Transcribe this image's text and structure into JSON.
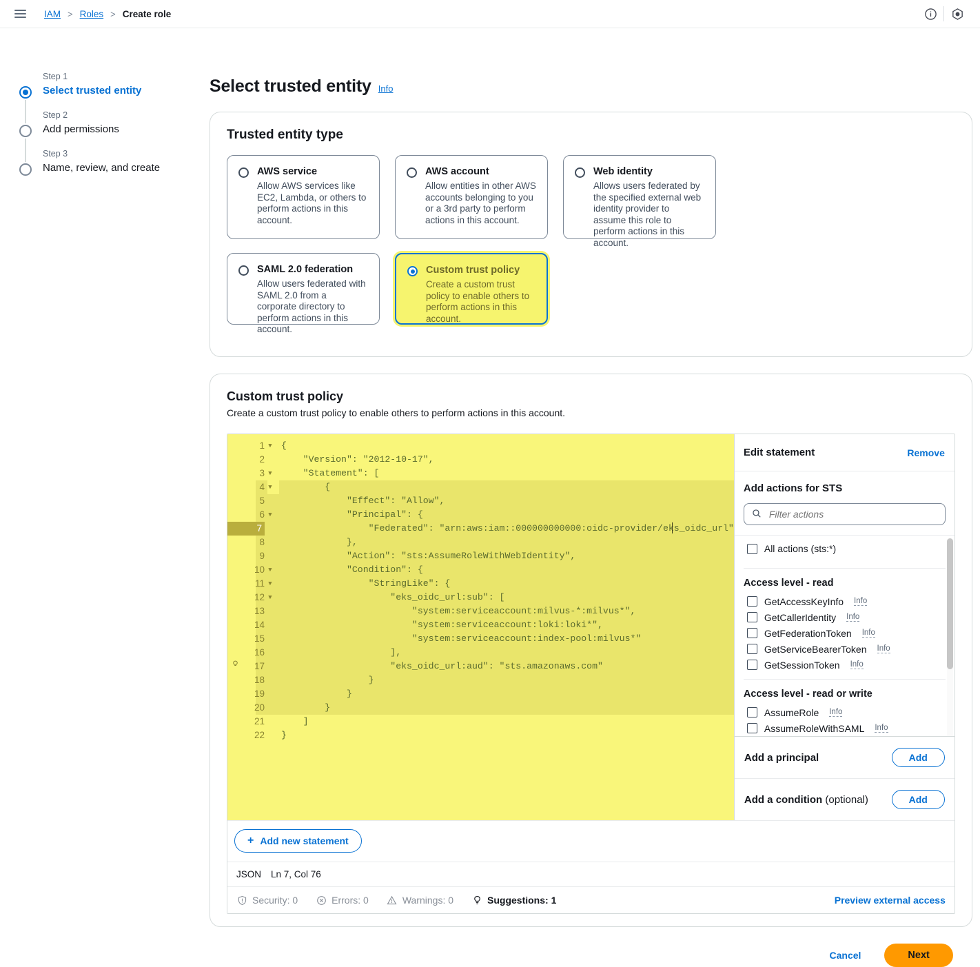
{
  "topbar": {
    "menu_icon": "hamburger-icon",
    "breadcrumbs": [
      {
        "label": "IAM",
        "link": true
      },
      {
        "label": "Roles",
        "link": true
      },
      {
        "label": "Create role",
        "link": false
      }
    ],
    "separator": ">",
    "icons": [
      {
        "name": "info-circle-icon",
        "glyph": "ⓘ"
      },
      {
        "name": "settings-hex-icon",
        "glyph": "⬡"
      }
    ]
  },
  "steps": [
    {
      "num": "Step 1",
      "label": "Select trusted entity",
      "active": true
    },
    {
      "num": "Step 2",
      "label": "Add permissions",
      "active": false
    },
    {
      "num": "Step 3",
      "label": "Name, review, and create",
      "active": false
    }
  ],
  "page": {
    "title": "Select trusted entity",
    "info_label": "Info"
  },
  "trusted_entity": {
    "section_title": "Trusted entity type",
    "cards": [
      {
        "label": "AWS service",
        "desc": "Allow AWS services like EC2, Lambda, or others to perform actions in this account.",
        "selected": false,
        "highlighted": false
      },
      {
        "label": "AWS account",
        "desc": "Allow entities in other AWS accounts belonging to you or a 3rd party to perform actions in this account.",
        "selected": false,
        "highlighted": false
      },
      {
        "label": "Web identity",
        "desc": "Allows users federated by the specified external web identity provider to assume this role to perform actions in this account.",
        "selected": false,
        "highlighted": false
      },
      {
        "label": "SAML 2.0 federation",
        "desc": "Allow users federated with SAML 2.0 from a corporate directory to perform actions in this account.",
        "selected": false,
        "highlighted": false
      },
      {
        "label": "Custom trust policy",
        "desc": "Create a custom trust policy to enable others to perform actions in this account.",
        "selected": true,
        "highlighted": true
      }
    ]
  },
  "custom_policy": {
    "section_title": "Custom trust policy",
    "section_desc": "Create a custom trust policy to enable others to perform actions in this account.",
    "code_lines": [
      {
        "n": "1",
        "fold": true,
        "bulb": false,
        "text": "{"
      },
      {
        "n": "2",
        "fold": false,
        "bulb": false,
        "text": "    \"Version\": \"2012-10-17\","
      },
      {
        "n": "3",
        "fold": true,
        "bulb": false,
        "text": "    \"Statement\": ["
      },
      {
        "n": "4",
        "fold": true,
        "bulb": false,
        "text": "        {"
      },
      {
        "n": "5",
        "fold": false,
        "bulb": false,
        "text": "            \"Effect\": \"Allow\","
      },
      {
        "n": "6",
        "fold": true,
        "bulb": false,
        "text": "            \"Principal\": {"
      },
      {
        "n": "7",
        "fold": false,
        "bulb": false,
        "text": "                \"Federated\": \"arn:aws:iam::000000000000:oidc-provider/eks_oidc_url\"",
        "current": true
      },
      {
        "n": "8",
        "fold": false,
        "bulb": false,
        "text": "            },"
      },
      {
        "n": "9",
        "fold": false,
        "bulb": false,
        "text": "            \"Action\": \"sts:AssumeRoleWithWebIdentity\","
      },
      {
        "n": "10",
        "fold": true,
        "bulb": false,
        "text": "            \"Condition\": {"
      },
      {
        "n": "11",
        "fold": true,
        "bulb": false,
        "text": "                \"StringLike\": {"
      },
      {
        "n": "12",
        "fold": true,
        "bulb": false,
        "text": "                    \"eks_oidc_url:sub\": ["
      },
      {
        "n": "13",
        "fold": false,
        "bulb": false,
        "text": "                        \"system:serviceaccount:milvus-*:milvus*\","
      },
      {
        "n": "14",
        "fold": false,
        "bulb": false,
        "text": "                        \"system:serviceaccount:loki:loki*\","
      },
      {
        "n": "15",
        "fold": false,
        "bulb": false,
        "text": "                        \"system:serviceaccount:index-pool:milvus*\""
      },
      {
        "n": "16",
        "fold": false,
        "bulb": false,
        "text": "                    ],"
      },
      {
        "n": "17",
        "fold": false,
        "bulb": true,
        "text": "                    \"eks_oidc_url:aud\": \"sts.amazonaws.com\""
      },
      {
        "n": "18",
        "fold": false,
        "bulb": false,
        "text": "                }"
      },
      {
        "n": "19",
        "fold": false,
        "bulb": false,
        "text": "            }"
      },
      {
        "n": "20",
        "fold": false,
        "bulb": false,
        "text": "        }"
      },
      {
        "n": "21",
        "fold": false,
        "bulb": false,
        "text": "    ]"
      },
      {
        "n": "22",
        "fold": false,
        "bulb": false,
        "text": "}"
      }
    ],
    "add_statement_label": "Add new statement",
    "add_statement_plus": "+",
    "status": {
      "language": "JSON",
      "cursor": "Ln 7, Col 76",
      "security": "Security: 0",
      "errors": "Errors: 0",
      "warnings": "Warnings: 0",
      "suggestions": "Suggestions: 1",
      "preview_link": "Preview external access"
    }
  },
  "side_panel": {
    "head_title": "Edit statement",
    "remove_label": "Remove",
    "actions_title": "Add actions for STS",
    "filter_placeholder": "Filter actions",
    "all_actions_label": "All actions (sts:*)",
    "groups": [
      {
        "title": "Access level - read",
        "actions": [
          {
            "label": "GetAccessKeyInfo",
            "info": "Info"
          },
          {
            "label": "GetCallerIdentity",
            "info": "Info"
          },
          {
            "label": "GetFederationToken",
            "info": "Info"
          },
          {
            "label": "GetServiceBearerToken",
            "info": "Info"
          },
          {
            "label": "GetSessionToken",
            "info": "Info"
          }
        ]
      },
      {
        "title": "Access level - read or write",
        "actions": [
          {
            "label": "AssumeRole",
            "info": "Info"
          },
          {
            "label": "AssumeRoleWithSAML",
            "info": "Info"
          }
        ]
      }
    ],
    "principal": {
      "title": "Add a principal",
      "button": "Add"
    },
    "condition": {
      "title": "Add a condition",
      "optional": " (optional)",
      "button": "Add"
    }
  },
  "footer": {
    "cancel": "Cancel",
    "next": "Next"
  },
  "colors": {
    "link": "#0972d3",
    "accent_orange": "#ff9900",
    "highlight_yellow": "#f6f46e",
    "editor_yellow": "#f9f67a"
  }
}
